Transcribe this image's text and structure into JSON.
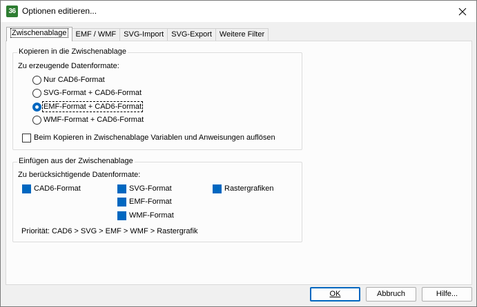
{
  "window": {
    "title": "Optionen editieren...",
    "app_icon_text": "36"
  },
  "tabs": [
    {
      "label": "Zwischenablage",
      "active": true
    },
    {
      "label": "EMF / WMF"
    },
    {
      "label": "SVG-Import"
    },
    {
      "label": "SVG-Export"
    },
    {
      "label": "Weitere Filter"
    }
  ],
  "copy_group": {
    "title": "Kopieren in die Zwischenablage",
    "formats_label": "Zu erzeugende Datenformate:",
    "options": [
      {
        "label": "Nur CAD6-Format",
        "checked": false
      },
      {
        "label": "SVG-Format + CAD6-Format",
        "checked": false
      },
      {
        "label": "EMF-Format + CAD6-Format",
        "checked": true
      },
      {
        "label": "WMF-Format + CAD6-Format",
        "checked": false
      }
    ],
    "resolve_checkbox": {
      "label": "Beim Kopieren in Zwischenablage Variablen und Anweisungen auflösen",
      "checked": false
    }
  },
  "paste_group": {
    "title": "Einfügen aus der Zwischenablage",
    "formats_label": "Zu berücksichtigende Datenformate:",
    "formats": [
      {
        "label": "CAD6-Format",
        "checked": true
      },
      {
        "label": "SVG-Format",
        "checked": true
      },
      {
        "label": "EMF-Format",
        "checked": true
      },
      {
        "label": "WMF-Format",
        "checked": true
      },
      {
        "label": "Rastergrafiken",
        "checked": true
      }
    ],
    "priority_text": "Priorität:  CAD6 > SVG > EMF > WMF > Rastergrafik"
  },
  "buttons": {
    "ok": "OK",
    "cancel": "Abbruch",
    "help": "Hilfe..."
  },
  "colors": {
    "accent": "#0067c0",
    "app_icon": "#2e7d32"
  }
}
